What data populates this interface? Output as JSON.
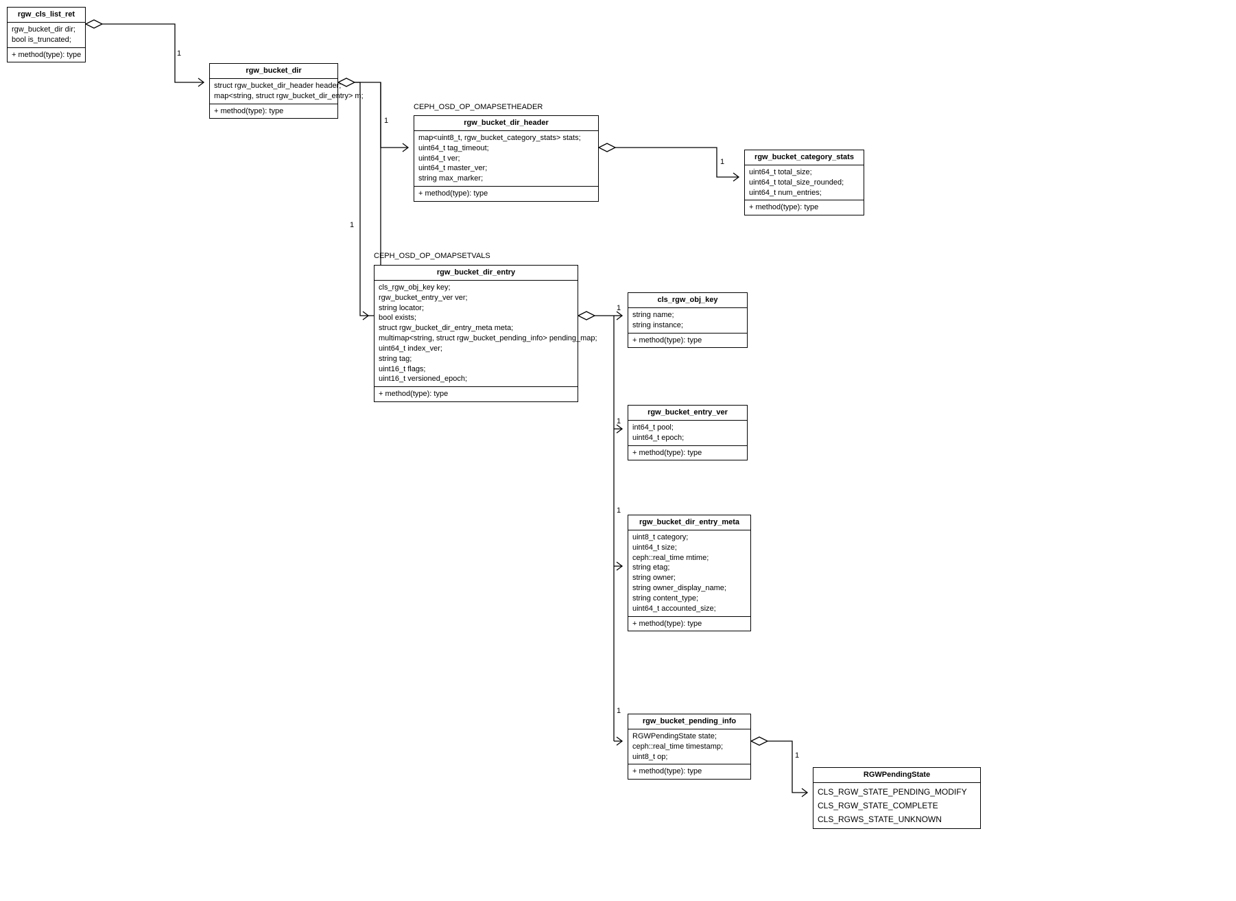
{
  "labels": {
    "omap_set_header": "CEPH_OSD_OP_OMAPSETHEADER",
    "omap_set_vals": "CEPH_OSD_OP_OMAPSETVALS"
  },
  "method_line": "+ method(type): type",
  "mults": {
    "one": "1"
  },
  "classes": {
    "rgw_cls_list_ret": {
      "title": "rgw_cls_list_ret",
      "attrs": [
        "rgw_bucket_dir dir;",
        "bool is_truncated;"
      ]
    },
    "rgw_bucket_dir": {
      "title": "rgw_bucket_dir",
      "attrs": [
        "struct rgw_bucket_dir_header header;",
        "map<string, struct rgw_bucket_dir_entry> m;"
      ]
    },
    "rgw_bucket_dir_header": {
      "title": "rgw_bucket_dir_header",
      "attrs": [
        "map<uint8_t, rgw_bucket_category_stats> stats;",
        "uint64_t tag_timeout;",
        "uint64_t ver;",
        "uint64_t master_ver;",
        "string max_marker;"
      ]
    },
    "rgw_bucket_category_stats": {
      "title": "rgw_bucket_category_stats",
      "attrs": [
        "uint64_t total_size;",
        "uint64_t total_size_rounded;",
        "uint64_t num_entries;"
      ]
    },
    "rgw_bucket_dir_entry": {
      "title": "rgw_bucket_dir_entry",
      "attrs": [
        "cls_rgw_obj_key key;",
        "rgw_bucket_entry_ver ver;",
        "string locator;",
        "bool exists;",
        "struct rgw_bucket_dir_entry_meta meta;",
        "multimap<string, struct rgw_bucket_pending_info> pending_map;",
        "uint64_t index_ver;",
        "string tag;",
        "uint16_t flags;",
        "uint16_t versioned_epoch;"
      ]
    },
    "cls_rgw_obj_key": {
      "title": "cls_rgw_obj_key",
      "attrs": [
        "string name;",
        "string instance;"
      ]
    },
    "rgw_bucket_entry_ver": {
      "title": "rgw_bucket_entry_ver",
      "attrs": [
        "int64_t pool;",
        "uint64_t epoch;"
      ]
    },
    "rgw_bucket_dir_entry_meta": {
      "title": "rgw_bucket_dir_entry_meta",
      "attrs": [
        "uint8_t category;",
        "uint64_t size;",
        "ceph::real_time mtime;",
        "string etag;",
        "string owner;",
        "string owner_display_name;",
        "string content_type;",
        "uint64_t accounted_size;"
      ]
    },
    "rgw_bucket_pending_info": {
      "title": "rgw_bucket_pending_info",
      "attrs": [
        "RGWPendingState state;",
        "ceph::real_time timestamp;",
        "uint8_t op;"
      ]
    },
    "RGWPendingState": {
      "title": "RGWPendingState",
      "values": [
        "CLS_RGW_STATE_PENDING_MODIFY",
        "CLS_RGW_STATE_COMPLETE",
        "CLS_RGWS_STATE_UNKNOWN"
      ]
    }
  },
  "chart_data": {
    "type": "uml-class-diagram",
    "nodes": [
      {
        "id": "rgw_cls_list_ret",
        "kind": "class"
      },
      {
        "id": "rgw_bucket_dir",
        "kind": "class"
      },
      {
        "id": "rgw_bucket_dir_header",
        "kind": "class",
        "annotation": "CEPH_OSD_OP_OMAPSETHEADER"
      },
      {
        "id": "rgw_bucket_category_stats",
        "kind": "class"
      },
      {
        "id": "rgw_bucket_dir_entry",
        "kind": "class",
        "annotation": "CEPH_OSD_OP_OMAPSETVALS"
      },
      {
        "id": "cls_rgw_obj_key",
        "kind": "class"
      },
      {
        "id": "rgw_bucket_entry_ver",
        "kind": "class"
      },
      {
        "id": "rgw_bucket_dir_entry_meta",
        "kind": "class"
      },
      {
        "id": "rgw_bucket_pending_info",
        "kind": "class"
      },
      {
        "id": "RGWPendingState",
        "kind": "enum"
      }
    ],
    "edges": [
      {
        "from": "rgw_cls_list_ret",
        "to": "rgw_bucket_dir",
        "type": "aggregation",
        "multiplicity_to": "1"
      },
      {
        "from": "rgw_bucket_dir",
        "to": "rgw_bucket_dir_header",
        "type": "aggregation",
        "multiplicity_to": "1"
      },
      {
        "from": "rgw_bucket_dir",
        "to": "rgw_bucket_dir_entry",
        "type": "aggregation",
        "multiplicity_to": "1"
      },
      {
        "from": "rgw_bucket_dir_header",
        "to": "rgw_bucket_category_stats",
        "type": "aggregation",
        "multiplicity_to": "1"
      },
      {
        "from": "rgw_bucket_dir_entry",
        "to": "cls_rgw_obj_key",
        "type": "aggregation",
        "multiplicity_to": "1"
      },
      {
        "from": "rgw_bucket_dir_entry",
        "to": "rgw_bucket_entry_ver",
        "type": "aggregation",
        "multiplicity_to": "1"
      },
      {
        "from": "rgw_bucket_dir_entry",
        "to": "rgw_bucket_dir_entry_meta",
        "type": "aggregation",
        "multiplicity_to": "1"
      },
      {
        "from": "rgw_bucket_dir_entry",
        "to": "rgw_bucket_pending_info",
        "type": "aggregation",
        "multiplicity_to": "1"
      },
      {
        "from": "rgw_bucket_pending_info",
        "to": "RGWPendingState",
        "type": "aggregation",
        "multiplicity_to": "1"
      }
    ]
  }
}
